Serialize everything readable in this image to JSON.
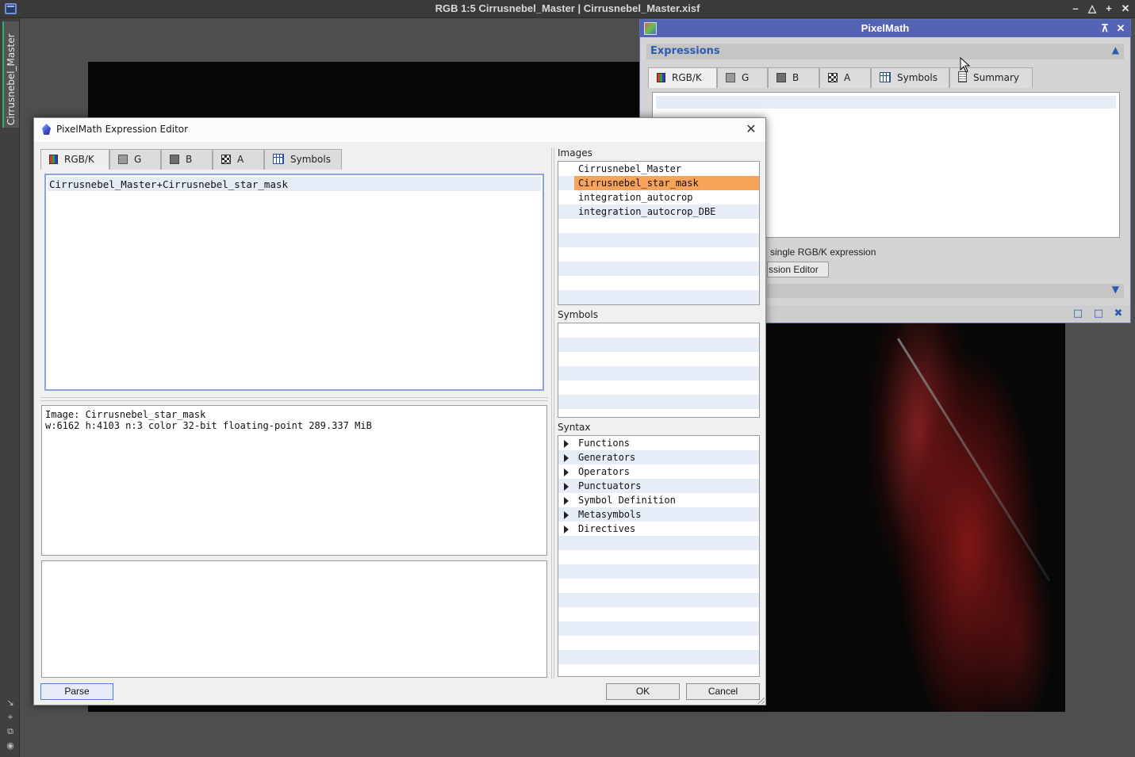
{
  "image_window": {
    "title": "RGB 1:5 Cirrusnebel_Master | Cirrusnebel_Master.xisf",
    "view_tab": "Cirrusnebel_Master"
  },
  "pixelmath": {
    "title": "PixelMath",
    "section": "Expressions",
    "tabs": [
      "RGB/K",
      "G",
      "B",
      "A",
      "Symbols",
      "Summary"
    ],
    "single_expression_fragment": "single RGB/K expression",
    "editor_button_fragment": "ssion Editor"
  },
  "editor": {
    "title": "PixelMath Expression Editor",
    "tabs": [
      "RGB/K",
      "G",
      "B",
      "A",
      "Symbols"
    ],
    "expression": "Cirrusnebel_Master+Cirrusnebel_star_mask",
    "info_line1": "Image: Cirrusnebel_star_mask",
    "info_line2": "w:6162 h:4103 n:3 color 32-bit floating-point 289.337 MiB",
    "images_label": "Images",
    "images": [
      "Cirrusnebel_Master",
      "Cirrusnebel_star_mask",
      "integration_autocrop",
      "integration_autocrop_DBE"
    ],
    "selected_image": "Cirrusnebel_star_mask",
    "symbols_label": "Symbols",
    "syntax_label": "Syntax",
    "syntax_items": [
      "Functions",
      "Generators",
      "Operators",
      "Punctuators",
      "Symbol Definition",
      "Metasymbols",
      "Directives"
    ],
    "parse_label": "Parse",
    "ok_label": "OK",
    "cancel_label": "Cancel"
  },
  "colors": {
    "accent": "#5563b4",
    "selection": "#f7a35a",
    "section_text": "#2a5db0"
  }
}
